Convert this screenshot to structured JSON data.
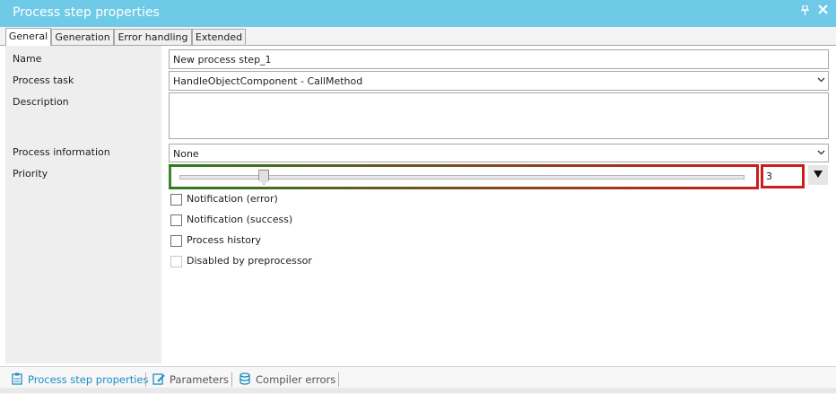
{
  "window": {
    "title": "Process step properties",
    "pin_glyph": "ₕ",
    "close_glyph": "✕"
  },
  "tabs": [
    {
      "label": "General",
      "active": true
    },
    {
      "label": "Generation",
      "active": false
    },
    {
      "label": "Error handling",
      "active": false
    },
    {
      "label": "Extended",
      "active": false
    }
  ],
  "form": {
    "name": {
      "label": "Name",
      "value": "New process step_1"
    },
    "process_task": {
      "label": "Process task",
      "value": "HandleObjectComponent - CallMethod"
    },
    "description": {
      "label": "Description",
      "value": ""
    },
    "process_information": {
      "label": "Process information",
      "value": "None"
    },
    "priority": {
      "label": "Priority",
      "value": "3",
      "slider_fraction": 0.15
    }
  },
  "checkboxes": [
    {
      "label": "Notification (error)",
      "checked": false,
      "enabled": true
    },
    {
      "label": "Notification (success)",
      "checked": false,
      "enabled": true
    },
    {
      "label": "Process history",
      "checked": false,
      "enabled": true
    },
    {
      "label": "Disabled by preprocessor",
      "checked": false,
      "enabled": false
    }
  ],
  "bottom_tabs": [
    {
      "label": "Process step properties",
      "icon": "clipboard-icon",
      "active": true
    },
    {
      "label": "Parameters",
      "icon": "edit-icon",
      "active": false
    },
    {
      "label": "Compiler errors",
      "icon": "database-icon",
      "active": false
    }
  ],
  "colors": {
    "title_bar": "#6fcae8",
    "accent": "#1c8fc4",
    "slider_green": "#3a8a2e",
    "slider_red": "#c81e1e"
  }
}
